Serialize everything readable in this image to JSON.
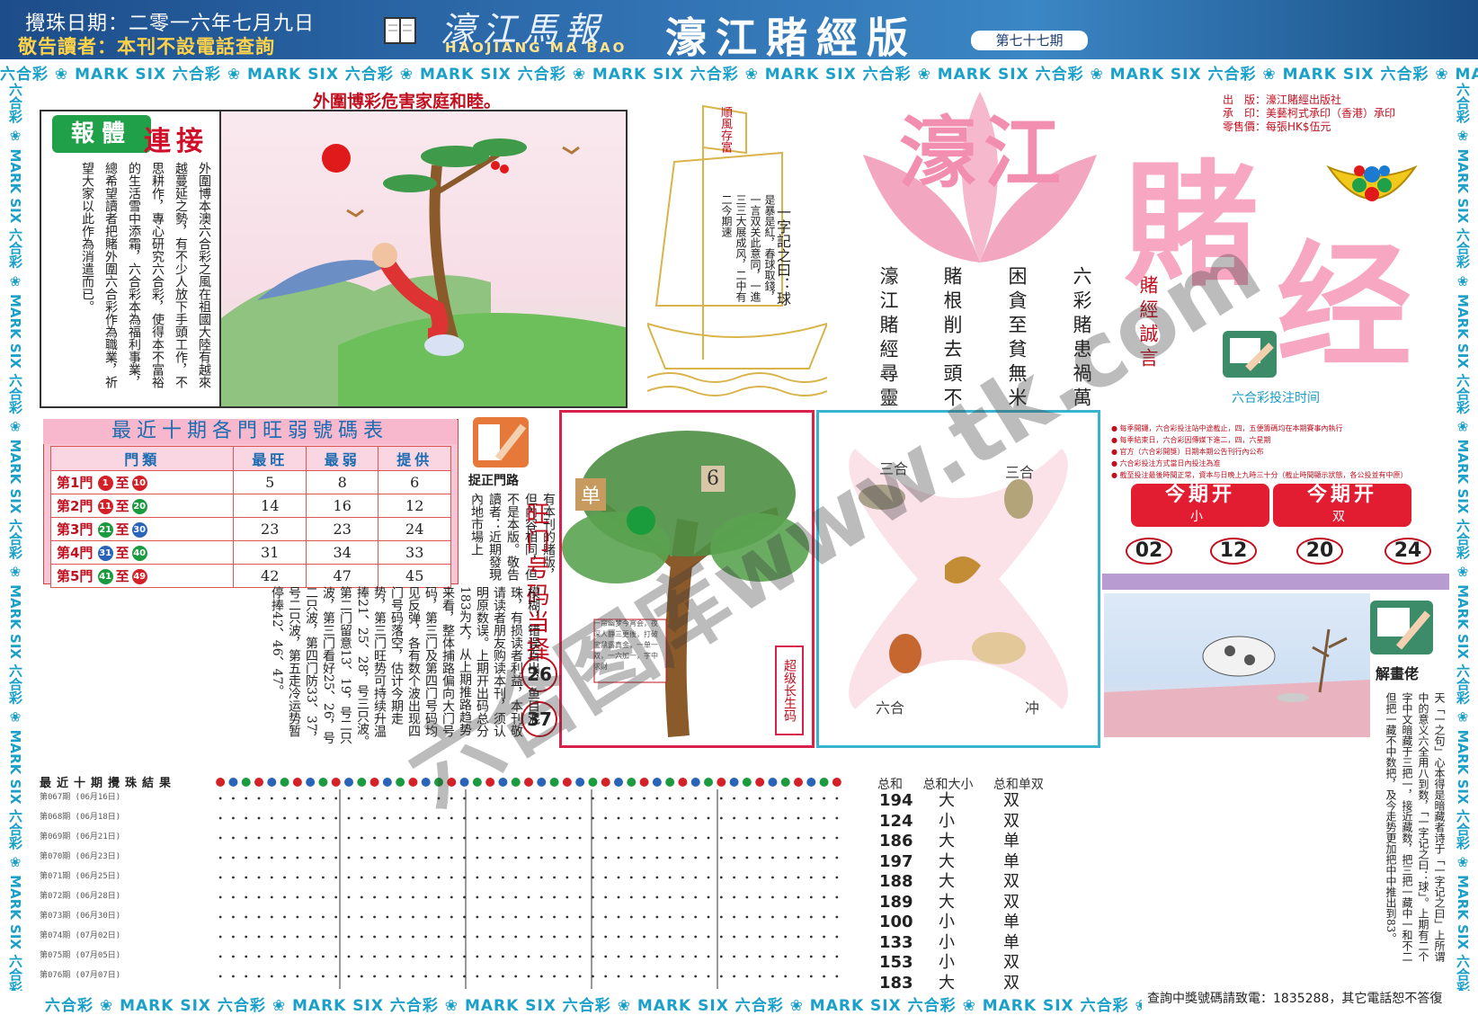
{
  "header": {
    "draw_date": "攪珠日期：二零一六年七月九日",
    "notice": "敬告讀者：本刊不設電話查詢",
    "brand_cn": "濠江馬報",
    "brand_en": "HAOJIANG MA BAO",
    "edition_title": "濠江賭經版",
    "issue": "第七十七期"
  },
  "marquee_text": "六合彩 ❀ MARK SIX 六合彩 ❀ MARK SIX 六合彩 ❀ MARK SIX 六合彩 ❀ MARK SIX 六合彩 ❀ MARK SIX 六合彩 ❀ MARK SIX 六合彩 ❀ MARK SIX 六合彩 ❀ MARK SIX 六合彩 ❀ MARK SIX 六合彩 ❀ MARK SIX",
  "warning": {
    "title": "外圍博彩危害家庭和睦。",
    "badge": "報體",
    "link": "連接",
    "article": "外圍博本澳六合彩之風在祖國大陸有越來越蔓延之勢，有不少人放下手頭工作，不思耕作，專心研究六合彩，使得本不富裕的生活雪中添霜，六合彩本為福利事業，總希望讀者把賭外圍六合彩作為職業，祈望大家以此作為消遣而已。"
  },
  "proverb": {
    "flag": "順風存富",
    "title": "一字記之曰：球",
    "body": "是暴是紅，春球取錢，一言双关此意同，一進三三大展成风，二中有二今期速"
  },
  "slogans": {
    "label": "賭經誠言",
    "lines": [
      "六彩賭患禍萬家",
      "困貪至貧無米炊",
      "賭根削去頭不回",
      "濠江賭經尋靈碼"
    ]
  },
  "big_title": {
    "haojiang": "濠江",
    "du": "賭",
    "jing": "经"
  },
  "publisher": {
    "lines": [
      "出　版：濠江賭經出版社",
      "承　印：美藝柯式承印（香港）承印",
      "零售價：每張HK$伍元"
    ]
  },
  "betting_time": {
    "title": "六合彩投注时间",
    "notes": [
      "● 每季開鑼，六合彩投注站中途截止，四，五便籌碼均在本期賽事內執行",
      "● 每季結束日，六合彩因傳媒下進二，四，六星期",
      "● 官方（六合彩開獎）日期本期公告刊行內公布",
      "● 六合彩投注方式當日內投注為准",
      "● 截至投注最後時間正常，資本与日晚上九時三十分（截止時間顯示狀態，各公投並有中原）"
    ]
  },
  "count_table": {
    "title": "最近十期各門旺弱號碼表",
    "headers": [
      "門類",
      "最旺",
      "最弱",
      "提供"
    ],
    "rows": [
      {
        "gate": "第1門",
        "from": "1",
        "to": "10",
        "hot": "5",
        "cold": "8",
        "provide": "6"
      },
      {
        "gate": "第2門",
        "from": "11",
        "to": "20",
        "hot": "14",
        "cold": "16",
        "provide": "12"
      },
      {
        "gate": "第3門",
        "from": "21",
        "to": "30",
        "hot": "23",
        "cold": "23",
        "provide": "24"
      },
      {
        "gate": "第4門",
        "from": "31",
        "to": "40",
        "hot": "31",
        "cold": "34",
        "provide": "33"
      },
      {
        "gate": "第5門",
        "from": "41",
        "to": "49",
        "hot": "42",
        "cold": "47",
        "provide": "45"
      }
    ],
    "connector": "至",
    "ball_colors": {
      "red": "#d42128",
      "green": "#1c9a3f",
      "blue": "#2a64b8"
    }
  },
  "gate_road": {
    "label": "捉正門路",
    "text": "有本刊的賭版，但內容相同，但不是本版。敬告讀者：近期發現內地市場上",
    "hot_label": "旺门号码当择",
    "hot_numbers": [
      "26",
      "37"
    ]
  },
  "long_article": "模糊，错误百出，鱼目混珠，有损读者利益，本刊敬请读者朋友购读本刊，须认明原数误。上期开出码总分183为大，从上期推路趋势来看，整体捕路偏向大门号码，第三门及第四门号码均见反弹，各有数个波出现四门号码落空，估计今期走势，第三门旺势可持续升温捧21、25、28，号三只波。第二门留意13、19，号二只波，第三门看好25、26，号二只波，第四门防33、37，号二只波，第五走冷运势暂停捧42、46、47。",
  "tree": {
    "tag_single": "单",
    "tag_six": "6",
    "caption": "超级长生码",
    "note": "一帘幽梦今宵会，夜深人静三更後，打破宝鼎露真金，一单一双，一六加一，字中求财"
  },
  "zodiac": {
    "labels": [
      "三合",
      "三合",
      "六合",
      "冲"
    ]
  },
  "current_issue": {
    "head": "今期开",
    "a_sub": "小",
    "b_sub": "双",
    "numbers": [
      "02",
      "12",
      "20",
      "24"
    ]
  },
  "interpreter": {
    "label": "解畫佬",
    "article": "天「一之句」心本得是暗藏者诗于「一字记之曰」上所谓中的意义六全用八到数，「一字记之曰：球」。上期有二个字中文暗藏于三把一，接近藏数，把三把一藏中一和不二但把一藏不中数把，及今走势更加把中中推出到83。"
  },
  "results": {
    "title": "最近十期攪珠結果",
    "header_numbers": [
      "1",
      "2",
      "3",
      "4",
      "5",
      "6",
      "7",
      "8",
      "9",
      "10",
      "11",
      "12",
      "13",
      "14",
      "15",
      "16",
      "17",
      "18",
      "19",
      "20",
      "21",
      "22",
      "23",
      "24",
      "25",
      "26",
      "27",
      "28",
      "29",
      "30",
      "31",
      "32",
      "33",
      "34",
      "35",
      "36",
      "37",
      "38",
      "39",
      "40",
      "41",
      "42",
      "43",
      "44",
      "45",
      "46",
      "47",
      "48",
      "49"
    ],
    "rows": [
      "第067期 (06月16日)",
      "第068期 (06月18日)",
      "第069期 (06月21日)",
      "第070期 (06月23日)",
      "第071期 (06月25日)",
      "第072期 (06月28日)",
      "第073期 (06月30日)",
      "第074期 (07月02日)",
      "第075期 (07月05日)",
      "第076期 (07月07日)"
    ],
    "sum_headers": [
      "总和",
      "总和大小",
      "总和单双"
    ],
    "sums": [
      {
        "total": "194",
        "size": "大",
        "parity": "双"
      },
      {
        "total": "124",
        "size": "小",
        "parity": "双"
      },
      {
        "total": "186",
        "size": "大",
        "parity": "单"
      },
      {
        "total": "197",
        "size": "大",
        "parity": "单"
      },
      {
        "total": "188",
        "size": "大",
        "parity": "双"
      },
      {
        "total": "189",
        "size": "大",
        "parity": "双"
      },
      {
        "total": "100",
        "size": "小",
        "parity": "单"
      },
      {
        "total": "133",
        "size": "小",
        "parity": "单"
      },
      {
        "total": "153",
        "size": "小",
        "parity": "双"
      },
      {
        "total": "183",
        "size": "大",
        "parity": "双"
      }
    ]
  },
  "inquiry": "查詢中獎號碼請致電：1835288，其它電話恕不答復",
  "watermark": "六合图库www.tk.com"
}
